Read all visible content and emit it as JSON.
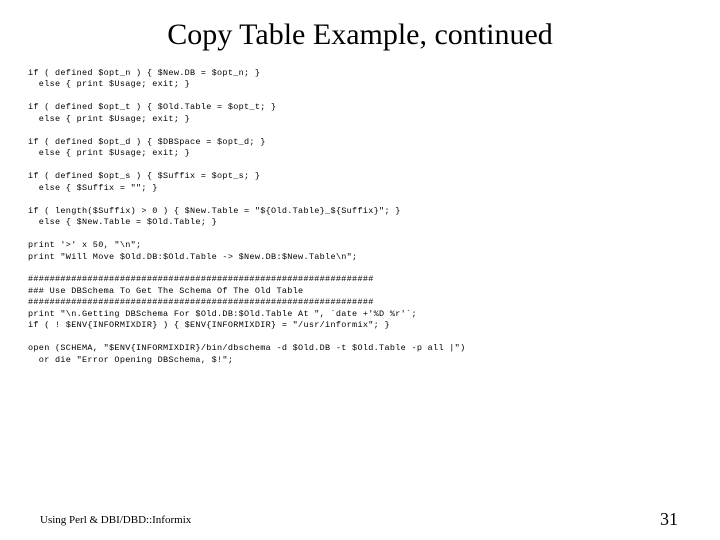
{
  "title": "Copy Table Example, continued",
  "code": "if ( defined $opt_n ) { $New.DB = $opt_n; }\n  else { print $Usage; exit; }\n\nif ( defined $opt_t ) { $Old.Table = $opt_t; }\n  else { print $Usage; exit; }\n\nif ( defined $opt_d ) { $DBSpace = $opt_d; }\n  else { print $Usage; exit; }\n\nif ( defined $opt_s ) { $Suffix = $opt_s; }\n  else { $Suffix = \"\"; }\n\nif ( length($Suffix) > 0 ) { $New.Table = \"${Old.Table}_${Suffix}\"; }\n  else { $New.Table = $Old.Table; }\n\nprint '>' x 50, \"\\n\";\nprint \"Will Move $Old.DB:$Old.Table -> $New.DB:$New.Table\\n\";\n\n################################################################\n### Use DBSchema To Get The Schema Of The Old Table\n################################################################\nprint \"\\n.Getting DBSchema For $Old.DB:$Old.Table At \", `date +'%D %r'`;\nif ( ! $ENV{INFORMIXDIR} ) { $ENV{INFORMIXDIR} = \"/usr/informix\"; }\n\nopen (SCHEMA, \"$ENV{INFORMIXDIR}/bin/dbschema -d $Old.DB -t $Old.Table -p all |\")\n  or die \"Error Opening DBSchema, $!\";",
  "footer_left": "Using Perl & DBI/DBD::Informix",
  "footer_right": "31"
}
